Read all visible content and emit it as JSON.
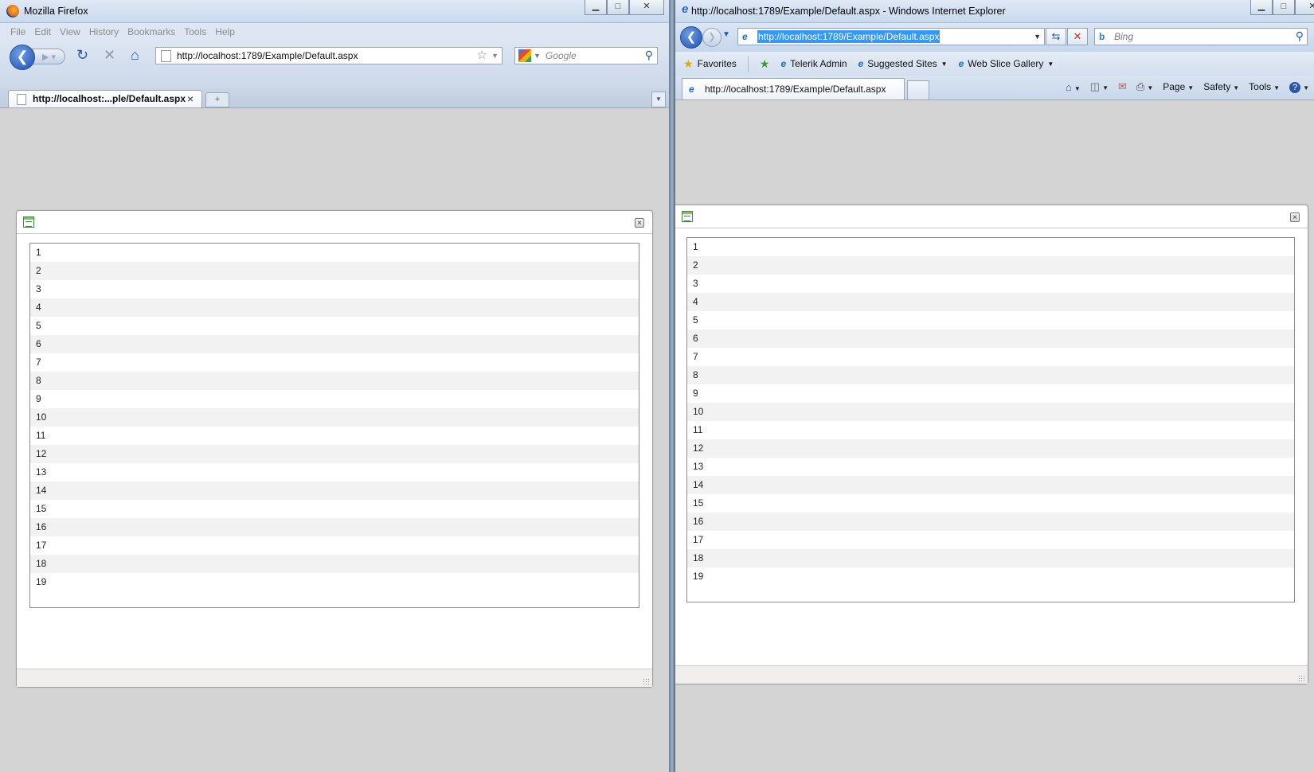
{
  "firefox": {
    "title": "Mozilla Firefox",
    "menu": [
      "File",
      "Edit",
      "View",
      "History",
      "Bookmarks",
      "Tools",
      "Help"
    ],
    "url": "http://localhost:1789/Example/Default.aspx",
    "search_placeholder": "Google",
    "tab_label": "http://localhost:...ple/Default.aspx",
    "list_items": [
      "1",
      "2",
      "3",
      "4",
      "5",
      "6",
      "7",
      "8",
      "9",
      "10",
      "11",
      "12",
      "13",
      "14",
      "15",
      "16",
      "17",
      "18",
      "19"
    ]
  },
  "ie": {
    "title": "http://localhost:1789/Example/Default.aspx - Windows Internet Explorer",
    "url": "http://localhost:1789/Example/Default.aspx",
    "search_placeholder": "Bing",
    "favorites_label": "Favorites",
    "fav_items": [
      "Telerik Admin",
      "Suggested Sites",
      "Web Slice Gallery"
    ],
    "tab_label": "http://localhost:1789/Example/Default.aspx",
    "cmd_page": "Page",
    "cmd_safety": "Safety",
    "cmd_tools": "Tools",
    "list_items": [
      "1",
      "2",
      "3",
      "4",
      "5",
      "6",
      "7",
      "8",
      "9",
      "10",
      "11",
      "12",
      "13",
      "14",
      "15",
      "16",
      "17",
      "18",
      "19"
    ]
  },
  "window_controls": {
    "minimize": "▁",
    "maximize": "□",
    "close": "✕"
  },
  "icons": {
    "back": "back-arrow-icon",
    "forward": "forward-arrow-icon",
    "reload": "reload-icon",
    "stop": "stop-icon",
    "home": "home-icon"
  }
}
